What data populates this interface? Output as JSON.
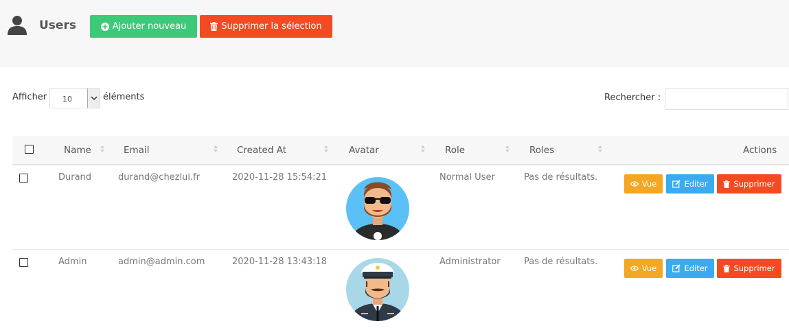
{
  "header": {
    "title": "Users",
    "add_label": "Ajouter nouveau",
    "delete_selection_label": "Supprimer la sélection"
  },
  "length": {
    "before": "Afficher",
    "value": "10",
    "after": "éléments"
  },
  "search": {
    "label": "Rechercher :",
    "value": ""
  },
  "table": {
    "columns": [
      "Name",
      "Email",
      "Created At",
      "Avatar",
      "Role",
      "Roles",
      "Actions"
    ],
    "rows": [
      {
        "name": "Durand",
        "email": "durand@chezlui.fr",
        "created_at": "2020-11-28 15:54:21",
        "role": "Normal User",
        "roles": "Pas de résultats."
      },
      {
        "name": "Admin",
        "email": "admin@admin.com",
        "created_at": "2020-11-28 13:43:18",
        "role": "Administrator",
        "roles": "Pas de résultats."
      }
    ],
    "actions": {
      "view": "Vue",
      "edit": "Editer",
      "delete": "Supprimer"
    }
  },
  "colors": {
    "add": "#3dc97a",
    "delete": "#f44a22",
    "view": "#f5a623",
    "edit": "#3aabf0"
  }
}
